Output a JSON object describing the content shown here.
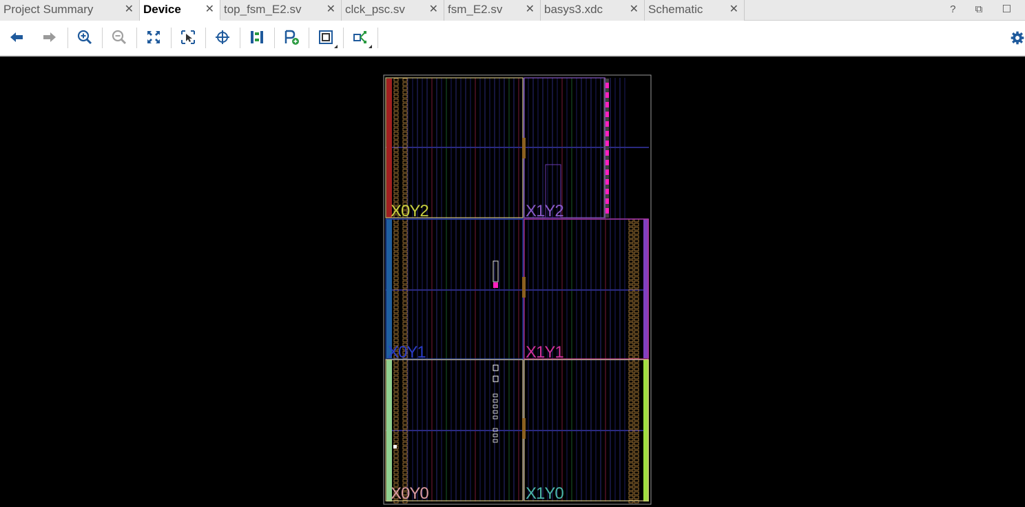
{
  "tabs": [
    {
      "label": "Project Summary",
      "active": false
    },
    {
      "label": "Device",
      "active": true
    },
    {
      "label": "top_fsm_E2.sv",
      "active": false
    },
    {
      "label": "clck_psc.sv",
      "active": false
    },
    {
      "label": "fsm_E2.sv",
      "active": false
    },
    {
      "label": "basys3.xdc",
      "active": false
    },
    {
      "label": "Schematic",
      "active": false
    }
  ],
  "tab_close_glyph": "✕",
  "window_controls": {
    "help": "?",
    "restore": "⧉",
    "maximize": "☐"
  },
  "toolbar": {
    "buttons": [
      {
        "icon": "back-arrow-icon"
      },
      {
        "icon": "forward-arrow-icon"
      },
      {
        "icon": "zoom-in-icon"
      },
      {
        "icon": "zoom-out-icon"
      },
      {
        "icon": "zoom-fit-icon"
      },
      {
        "icon": "zoom-selection-icon"
      },
      {
        "icon": "auto-fit-crosshair-icon"
      },
      {
        "icon": "routing-resources-icon"
      },
      {
        "icon": "add-pblock-icon"
      },
      {
        "icon": "device-view-options-icon"
      },
      {
        "icon": "net-display-icon"
      }
    ],
    "settings_icon": "gear-icon"
  },
  "device": {
    "clock_regions": [
      {
        "label": "X0Y2",
        "color": "#c8d040"
      },
      {
        "label": "X1Y2",
        "color": "#8a5ac8"
      },
      {
        "label": "X0Y1",
        "color": "#2a3cc8"
      },
      {
        "label": "X1Y1",
        "color": "#d0309a"
      },
      {
        "label": "X0Y0",
        "color": "#d89aa0"
      },
      {
        "label": "X1Y0",
        "color": "#4ab4a8"
      }
    ],
    "colors": {
      "outline": "#9a9a9a",
      "frame": "#d0c080",
      "grid_line": "#1c1c60",
      "io_bank_left_top": "#a02020",
      "io_bank_left_mid": "#1f5fa0",
      "io_bank_left_bottom": "#90d090",
      "io_bank_right_mid": "#8040c0",
      "io_bank_right_bottom": "#a0e040",
      "highlight_cell": "#ff20c0"
    }
  }
}
